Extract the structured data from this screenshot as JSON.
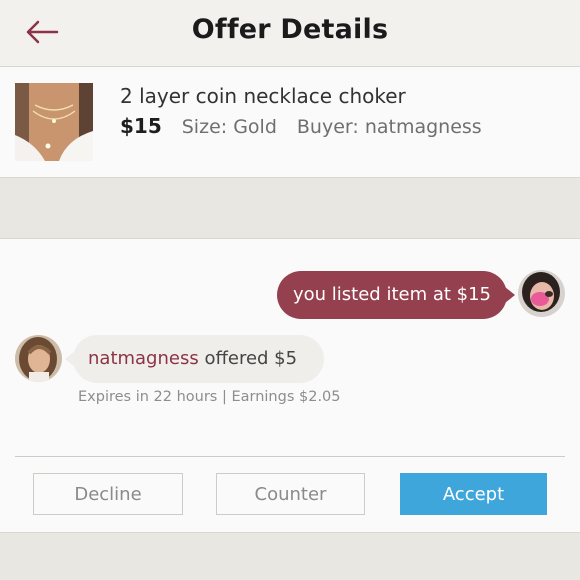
{
  "header": {
    "title": "Offer Details",
    "back_icon": "back-arrow-icon"
  },
  "item": {
    "title": "2 layer coin necklace choker",
    "price": "$15",
    "size": "Size: Gold",
    "buyer": "Buyer: natmagness"
  },
  "chat": {
    "seller_message": "you listed item at $15",
    "buyer_name": "natmagness",
    "buyer_action": " offered $5",
    "expires": "Expires in 22 hours | Earnings $2.05"
  },
  "actions": {
    "decline": "Decline",
    "counter": "Counter",
    "accept": "Accept"
  },
  "colors": {
    "accent_maroon": "#95404e",
    "accept_blue": "#3fa6dc"
  }
}
